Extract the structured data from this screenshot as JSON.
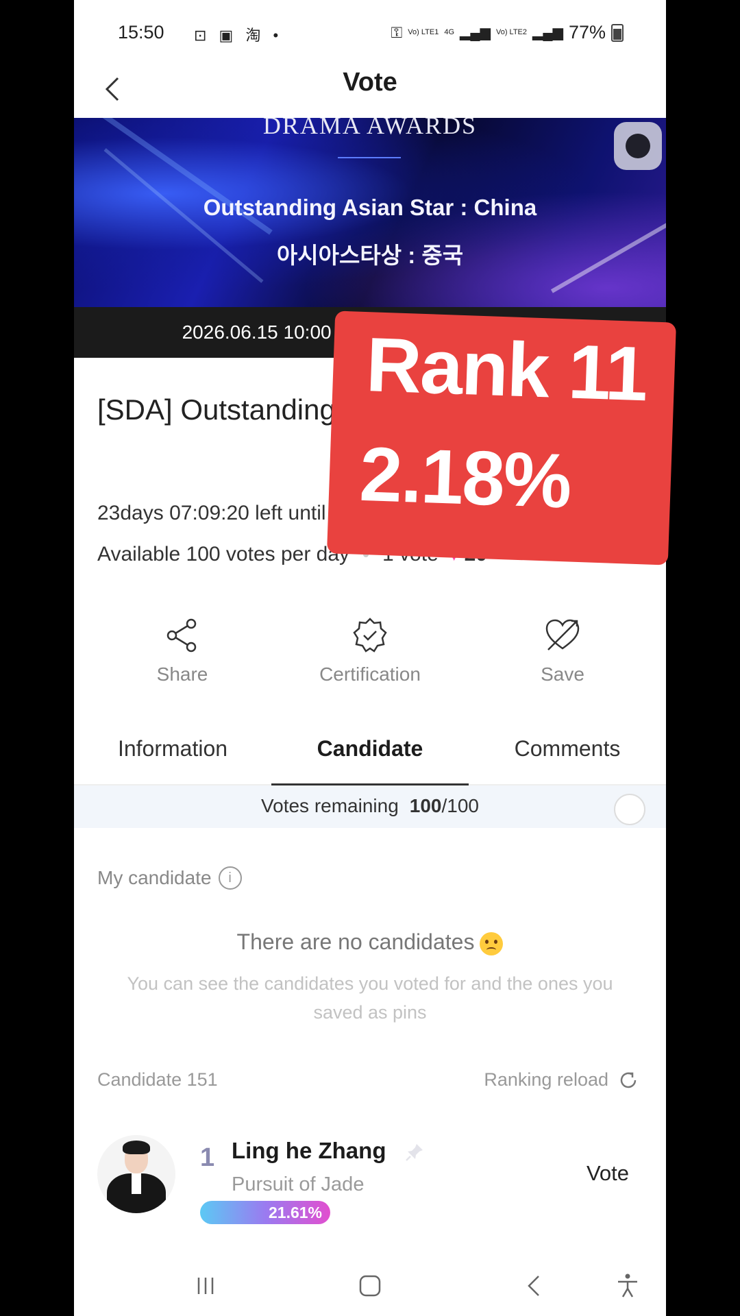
{
  "status_bar": {
    "time": "15:50",
    "left_icons": "⊡ ▣ 淘 •",
    "network1": "Vo) LTE1",
    "network2": "Vo) LTE2",
    "lte_tag": "4G",
    "battery": "77%"
  },
  "header": {
    "title": "Vote"
  },
  "banner": {
    "award_name": "DRAMA AWARDS",
    "title_en": "Outstanding Asian Star : China",
    "title_ko": "아시아스타상 : 중국"
  },
  "date_strip": {
    "text": "2026.06.15 10:00 ~ 2026.07.14 23:59 (KST)"
  },
  "vote_info": {
    "title": "[SDA] Outstanding Asian Star : China",
    "time_left": "23days 07:09:20 left until the end",
    "available": "Available 100 votes per day",
    "per_vote": "1 vote",
    "heart_count": "20"
  },
  "actions": [
    {
      "label": "Share",
      "icon": "share-icon"
    },
    {
      "label": "Certification",
      "icon": "certification-badge-icon"
    },
    {
      "label": "Save",
      "icon": "heart-arrow-icon"
    }
  ],
  "tabs": [
    {
      "label": "Information"
    },
    {
      "label": "Candidate",
      "active": true
    },
    {
      "label": "Comments"
    }
  ],
  "votes_remaining": {
    "label": "Votes remaining",
    "current": "100",
    "total": "/100"
  },
  "my_candidate": {
    "label": "My candidate",
    "empty_title": "There are no candidates",
    "empty_desc": "You can see the candidates you voted for and the ones you saved as pins"
  },
  "candidates_header": {
    "count_label": "Candidate 151",
    "reload_label": "Ranking reload"
  },
  "candidates": [
    {
      "rank": "1",
      "name": "Ling he Zhang",
      "work": "Pursuit of Jade",
      "percent": "21.61%",
      "percent_value": 21.61,
      "vote_label": "Vote"
    }
  ],
  "overlay": {
    "line1": "Rank 11",
    "line2": "2.18%"
  },
  "colors": {
    "accent": "#e9423f",
    "heart": "#ff3fa6",
    "bar_start": "#5cc9f4",
    "bar_end": "#e14fcf"
  }
}
